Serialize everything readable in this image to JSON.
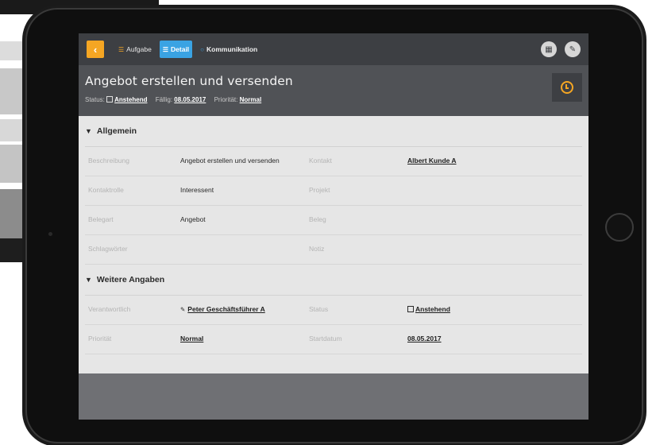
{
  "tabs": {
    "back_label": "‹",
    "aufgabe": "Aufgabe",
    "detail": "Detail",
    "kommunikation": "Kommunikation"
  },
  "header": {
    "title": "Angebot erstellen und versenden",
    "status_label": "Status:",
    "status_value": "Anstehend",
    "due_label": "Fällig:",
    "due_value": "08.05.2017",
    "priority_label": "Priorität:",
    "priority_value": "Normal"
  },
  "sections": {
    "allgemein": {
      "title": "Allgemein",
      "rows": [
        {
          "l1": "Beschreibung",
          "v1": "Angebot erstellen und versenden",
          "l2": "Kontakt",
          "v2": "Albert Kunde A"
        },
        {
          "l1": "Kontaktrolle",
          "v1": "Interessent",
          "l2": "Projekt",
          "v2": ""
        },
        {
          "l1": "Belegart",
          "v1": "Angebot",
          "l2": "Beleg",
          "v2": ""
        },
        {
          "l1": "Schlagwörter",
          "v1": "",
          "l2": "Notiz",
          "v2": ""
        }
      ]
    },
    "weitere": {
      "title": "Weitere Angaben",
      "rows": [
        {
          "l1": "Verantwortlich",
          "v1": "Peter Geschäftsführer A",
          "l2": "Status",
          "v2": "Anstehend"
        },
        {
          "l1": "Priorität",
          "v1": "Normal",
          "l2": "Startdatum",
          "v2": "08.05.2017"
        }
      ]
    }
  },
  "icons": {
    "aufgabe": "list-icon",
    "detail": "detail-icon",
    "kommunikation": "chat-icon",
    "calendar": "calendar-icon",
    "edit": "pencil-icon",
    "clock": "clock-icon"
  },
  "colors": {
    "accent_orange": "#f5a623",
    "accent_blue": "#3aa3e3",
    "nav_bg": "#3d3f43",
    "header_bg": "#505256"
  }
}
